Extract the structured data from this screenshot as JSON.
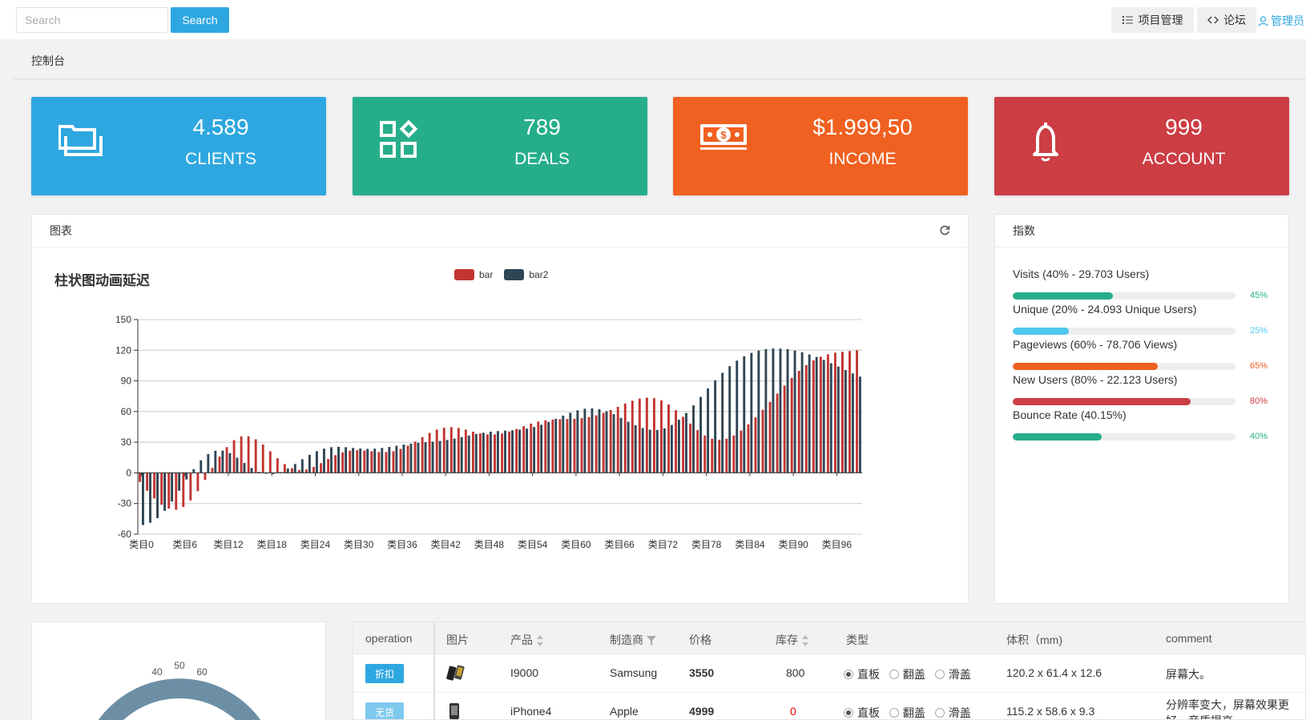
{
  "header": {
    "search_placeholder": "Search",
    "search_button": "Search",
    "project_btn": "项目管理",
    "forum_btn": "论坛",
    "admin_link": "管理员"
  },
  "breadcrumb": "控制台",
  "stats": [
    {
      "value": "4.589",
      "label": "CLIENTS",
      "color": "#2ea7e0",
      "icon": "folders-icon"
    },
    {
      "value": "789",
      "label": "DEALS",
      "color": "#26ae8b",
      "icon": "apps-icon"
    },
    {
      "value": "$1.999,50",
      "label": "INCOME",
      "color": "#f06020",
      "icon": "money-icon"
    },
    {
      "value": "999",
      "label": "ACCOUNT",
      "color": "#cc3d44",
      "icon": "bell-icon"
    }
  ],
  "chart_panel": {
    "title": "图表"
  },
  "chart_data": {
    "type": "bar",
    "title": "柱状图动画延迟",
    "legend_position": "top",
    "grid": true,
    "ylim": [
      -60,
      150
    ],
    "yticks": [
      -60,
      -30,
      0,
      30,
      60,
      90,
      120,
      150
    ],
    "tick_labels": [
      "类目0",
      "类目6",
      "类目12",
      "类目18",
      "类目24",
      "类目30",
      "类目36",
      "类目42",
      "类目48",
      "类目54",
      "类目60",
      "类目66",
      "类目72",
      "类目78",
      "类目84",
      "类目90",
      "类目96"
    ],
    "categories_prefix": "类目",
    "category_count": 100,
    "series": [
      {
        "name": "bar",
        "color": "#c23531",
        "values": [
          -8.9,
          -17.5,
          -25.1,
          -31.2,
          -35.0,
          -36.1,
          -33.4,
          -27.0,
          -17.9,
          -6.8,
          4.9,
          15.9,
          25.2,
          32.0,
          35.6,
          35.8,
          32.9,
          27.7,
          21.1,
          14.3,
          8.6,
          4.6,
          2.8,
          3.3,
          5.8,
          9.5,
          13.6,
          17.3,
          20.0,
          21.7,
          22.2,
          21.8,
          21.1,
          20.4,
          20.3,
          21.2,
          23.4,
          26.6,
          30.6,
          35.0,
          39.1,
          42.3,
          44.2,
          44.8,
          44.0,
          42.3,
          40.3,
          38.6,
          37.6,
          37.6,
          38.6,
          40.5,
          43.0,
          45.7,
          48.2,
          50.2,
          51.4,
          52.1,
          52.5,
          52.7,
          52.9,
          53.5,
          54.6,
          56.3,
          58.6,
          61.5,
          64.6,
          67.8,
          70.6,
          72.7,
          73.6,
          73.1,
          70.9,
          66.9,
          61.3,
          54.9,
          48.2,
          41.8,
          36.6,
          33.4,
          32.3,
          33.4,
          36.6,
          41.4,
          47.4,
          54.3,
          61.7,
          69.5,
          77.5,
          85.4,
          92.9,
          99.8,
          105.5,
          110.1,
          113.6,
          116.0,
          117.6,
          118.5,
          119.2,
          120.0
        ]
      },
      {
        "name": "bar2",
        "color": "#2f4554",
        "values": [
          -51.0,
          -48.8,
          -44.3,
          -37.2,
          -28.0,
          -17.5,
          -6.5,
          3.7,
          12.3,
          18.4,
          21.6,
          21.8,
          19.3,
          14.9,
          9.7,
          4.7,
          1.0,
          -0.9,
          -1.1,
          0.8,
          4.3,
          8.7,
          13.3,
          17.6,
          21.2,
          23.7,
          25.1,
          25.5,
          25.1,
          24.4,
          23.8,
          23.5,
          23.7,
          24.4,
          25.4,
          26.5,
          27.7,
          28.6,
          29.4,
          30.0,
          30.5,
          31.2,
          32.2,
          33.5,
          35.0,
          36.6,
          38.1,
          39.3,
          40.3,
          40.9,
          41.3,
          41.7,
          42.3,
          43.3,
          44.9,
          47.1,
          49.8,
          52.9,
          56.0,
          58.9,
          61.2,
          62.7,
          63.1,
          62.3,
          60.3,
          57.4,
          53.8,
          50.0,
          46.6,
          43.8,
          42.2,
          42.0,
          43.6,
          46.9,
          52.0,
          58.5,
          66.0,
          74.3,
          82.6,
          90.6,
          97.9,
          104.4,
          109.8,
          114.1,
          117.4,
          119.7,
          121.1,
          121.7,
          121.6,
          121.0,
          119.7,
          118.0,
          115.9,
          113.4,
          110.5,
          107.3,
          104.0,
          100.6,
          97.3,
          94.2
        ]
      }
    ]
  },
  "stats_panel": {
    "title": "指数",
    "items": [
      {
        "label": "Visits (40% - 29.703 Users)",
        "pct": 45,
        "pct_text": "45%",
        "color": "#26ae8b"
      },
      {
        "label": "Unique (20% - 24.093 Unique Users)",
        "pct": 25,
        "pct_text": "25%",
        "color": "#4fc7f0"
      },
      {
        "label": "Pageviews (60% - 78.706 Views)",
        "pct": 65,
        "pct_text": "65%",
        "color": "#f06020"
      },
      {
        "label": "New Users (80% - 22.123 Users)",
        "pct": 80,
        "pct_text": "80%",
        "color": "#cc3d44"
      },
      {
        "label": "Bounce Rate (40.15%)",
        "pct": 40,
        "pct_text": "40%",
        "color": "#26ae8b"
      }
    ]
  },
  "gauge": {
    "ticks": [
      "40",
      "50",
      "60"
    ]
  },
  "table": {
    "headers": [
      "operation",
      "图片",
      "产品",
      "制造商",
      "价格",
      "库存",
      "类型",
      "体积（mm)",
      "comment"
    ],
    "type_options": [
      "直板",
      "翻盖",
      "滑盖"
    ],
    "rows": [
      {
        "op": "折扣",
        "op_color": "#2ea7e0",
        "product": "I9000",
        "maker": "Samsung",
        "price": "3550",
        "stock": "800",
        "stock_color": "#333333",
        "type": "直板",
        "size": "120.2 x 61.4 x 12.6",
        "comment": "屏幕大。"
      },
      {
        "op": "无货",
        "op_color": "#7fc9ee",
        "product": "iPhone4",
        "maker": "Apple",
        "price": "4999",
        "stock": "0",
        "stock_color": "#e00000",
        "type": "直板",
        "size": "115.2 x 58.6 x 9.3",
        "comment": "分辨率变大，屏幕效果更好，音质提高"
      }
    ]
  }
}
